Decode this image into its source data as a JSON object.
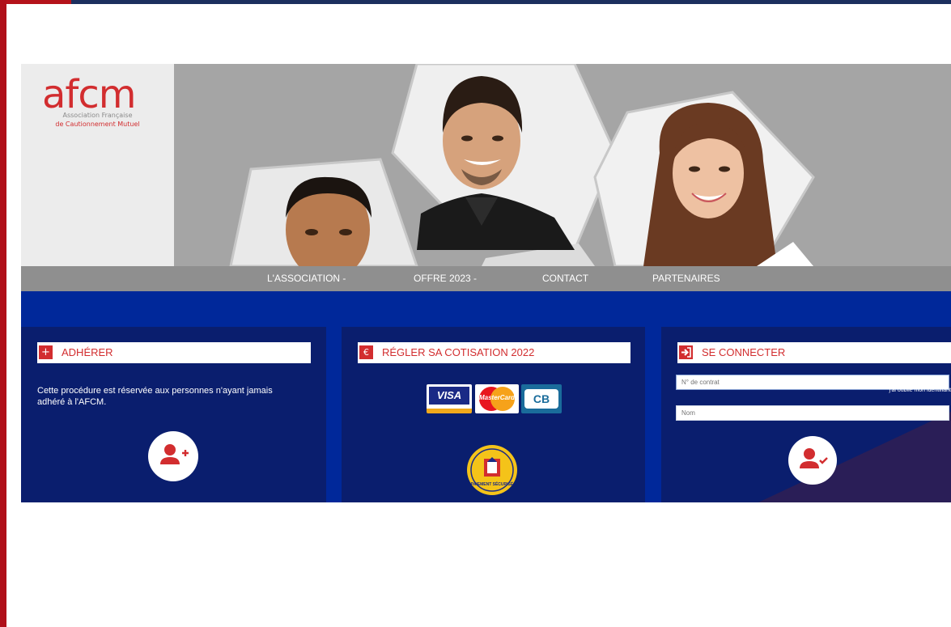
{
  "logo": {
    "word": "afcm",
    "line1": "Association Française",
    "line2": "de Cautionnement Mutuel"
  },
  "nav": [
    {
      "label": "L'ASSOCIATION -"
    },
    {
      "label": "OFFRE 2023 -"
    },
    {
      "label": "CONTACT"
    },
    {
      "label": "PARTENAIRES"
    }
  ],
  "adherer": {
    "icon": "plus-icon",
    "title": "ADHÉRER",
    "description": "Cette procédure est réservée aux personnes n'ayant jamais adhéré à l'AFCM."
  },
  "cotisation": {
    "icon": "euro-icon",
    "title": "RÉGLER SA COTISATION 2022",
    "cards": [
      "VISA",
      "MasterCard",
      "CB"
    ],
    "seal": "PAIEMENT SÉCURISÉ"
  },
  "connecter": {
    "icon": "login-icon",
    "title": "SE CONNECTER",
    "contract_placeholder": "N° de contrat",
    "forgot": "j'ai oublié mon identifiant",
    "name_placeholder": "Nom"
  },
  "colors": {
    "brand_red": "#d22d2f",
    "navy": "#0a1e6e",
    "royal_blue": "#00289a",
    "nav_grey": "#8f8f8f"
  }
}
